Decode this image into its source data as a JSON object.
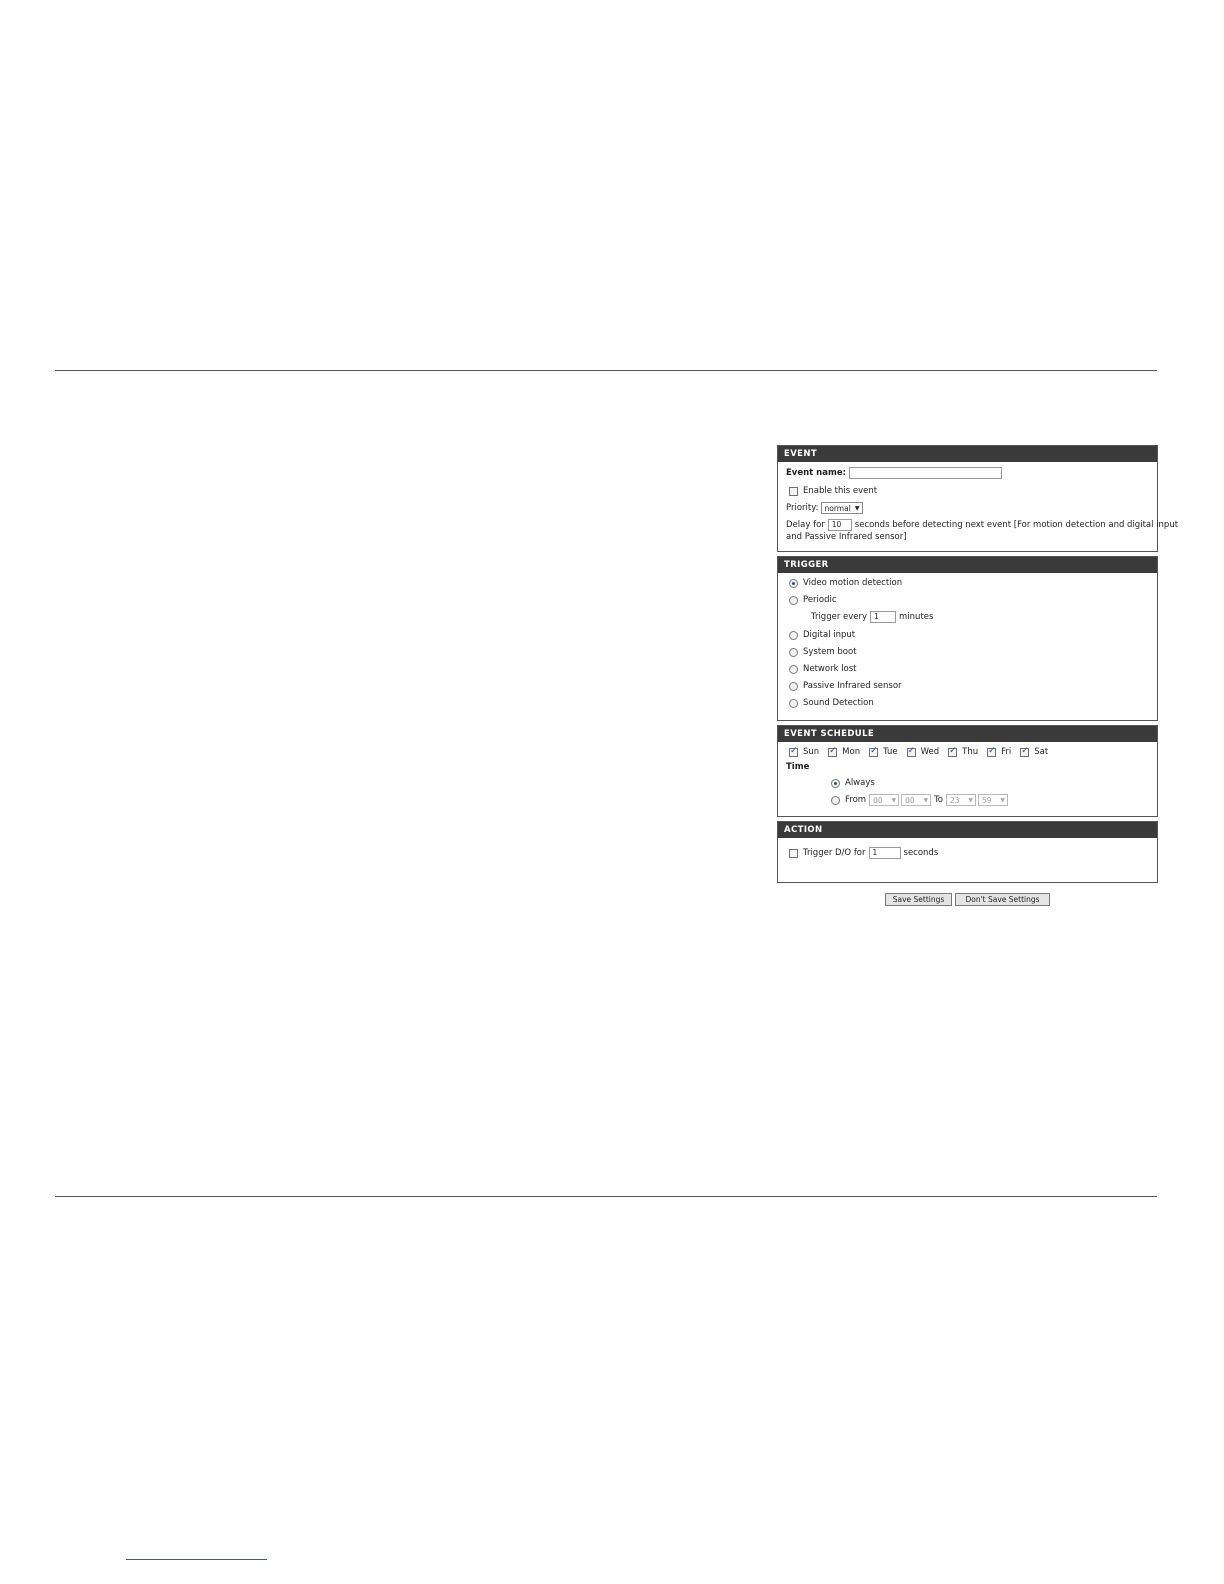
{
  "event": {
    "header": "EVENT",
    "name_label": "Event name:",
    "name_value": "",
    "enable_label": "Enable this event",
    "priority_label": "Priority:",
    "priority_value": "normal",
    "delay_label": "Delay for",
    "delay_value": "10",
    "delay_suffix_line1": "seconds before detecting next event [For motion detection and digital input",
    "delay_suffix_line2": "and Passive Infrared sensor]"
  },
  "trigger": {
    "header": "TRIGGER",
    "options": [
      {
        "label": "Video motion detection",
        "selected": true
      },
      {
        "label": "Periodic",
        "selected": false
      },
      {
        "label": "Digital input",
        "selected": false
      },
      {
        "label": "System boot",
        "selected": false
      },
      {
        "label": "Network lost",
        "selected": false
      },
      {
        "label": "Passive Infrared sensor",
        "selected": false
      },
      {
        "label": "Sound Detection",
        "selected": false
      }
    ],
    "periodic_prefix": "Trigger every",
    "periodic_value": "1",
    "periodic_suffix": "minutes"
  },
  "schedule": {
    "header": "EVENT SCHEDULE",
    "days": [
      "Sun",
      "Mon",
      "Tue",
      "Wed",
      "Thu",
      "Fri",
      "Sat"
    ],
    "time_label": "Time",
    "always_label": "Always",
    "from_label": "From",
    "to_label": "To",
    "from_hour": "00",
    "from_min": "00",
    "to_hour": "23",
    "to_min": "59"
  },
  "action": {
    "header": "ACTION",
    "trigger_label": "Trigger D/O for",
    "trigger_value": "1",
    "trigger_suffix": "seconds"
  },
  "buttons": {
    "save": "Save Settings",
    "dont_save": "Don't Save Settings"
  }
}
